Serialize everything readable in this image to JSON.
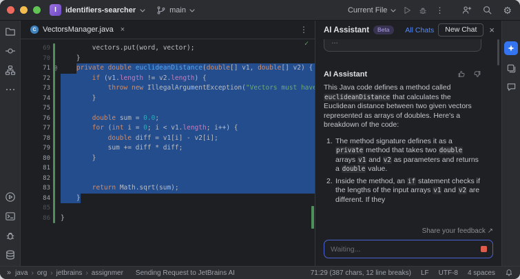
{
  "colors": {
    "accent": "#3574f0",
    "selection": "#234d8d",
    "editor_bg": "#1e1f22",
    "panel_bg": "#2b2d30",
    "keyword": "#cf8e6d",
    "method": "#56a8f5",
    "string": "#6aab73",
    "number": "#2aacb8",
    "field": "#c77dbb",
    "code_text": "#bcbec4",
    "link": "#548af7",
    "beta_text": "#b3a1ef",
    "stop_button": "#dd5c4c",
    "change_marker": "#4e8f5c",
    "success": "#5fad65"
  },
  "titlebar": {
    "project_name": "identifiers-searcher",
    "project_initial": "I",
    "branch_name": "main",
    "run_config": "Current File"
  },
  "tabbar": {
    "tab_title": "VectorsManager.java",
    "close_glyph": "×",
    "kebab_glyph": "⋮",
    "inspection_glyph": "✓"
  },
  "editor": {
    "lines": [
      {
        "n": 69,
        "sel": "none",
        "t": [
          [
            "pln",
            "        vectors.put(word, vector);"
          ]
        ]
      },
      {
        "n": 70,
        "sel": "none",
        "t": [
          [
            "pln",
            "    }"
          ]
        ]
      },
      {
        "n": 71,
        "sel": "tail",
        "mark": "@",
        "pre": [
          [
            "pln",
            "    "
          ]
        ],
        "t": [
          [
            "kw",
            "private"
          ],
          [
            "pln",
            " "
          ],
          [
            "kw",
            "double"
          ],
          [
            "pln",
            " "
          ],
          [
            "fn",
            "euclideanDistance"
          ],
          [
            "pln",
            "("
          ],
          [
            "kw",
            "double"
          ],
          [
            "pln",
            "[] v1, "
          ],
          [
            "kw",
            "double"
          ],
          [
            "pln",
            "[] v2) {"
          ]
        ]
      },
      {
        "n": 72,
        "sel": "full",
        "t": [
          [
            "pln",
            "        "
          ],
          [
            "kw",
            "if"
          ],
          [
            "pln",
            " (v1."
          ],
          [
            "fld",
            "length"
          ],
          [
            "pln",
            " != v2."
          ],
          [
            "fld",
            "length"
          ],
          [
            "pln",
            ") {"
          ]
        ]
      },
      {
        "n": 73,
        "sel": "full",
        "t": [
          [
            "pln",
            "            "
          ],
          [
            "kw",
            "throw"
          ],
          [
            "pln",
            " "
          ],
          [
            "kw",
            "new"
          ],
          [
            "pln",
            " IllegalArgumentException("
          ],
          [
            "str",
            "\"Vectors must have th"
          ]
        ]
      },
      {
        "n": 74,
        "sel": "full",
        "t": [
          [
            "pln",
            "        }"
          ]
        ]
      },
      {
        "n": 75,
        "sel": "full",
        "t": []
      },
      {
        "n": 76,
        "sel": "full",
        "t": [
          [
            "pln",
            "        "
          ],
          [
            "kw",
            "double"
          ],
          [
            "pln",
            " sum = "
          ],
          [
            "num",
            "0.0"
          ],
          [
            "pln",
            ";"
          ]
        ]
      },
      {
        "n": 77,
        "sel": "full",
        "t": [
          [
            "pln",
            "        "
          ],
          [
            "kw",
            "for"
          ],
          [
            "pln",
            " ("
          ],
          [
            "kw",
            "int"
          ],
          [
            "pln",
            " i = "
          ],
          [
            "num",
            "0"
          ],
          [
            "pln",
            "; i < v1."
          ],
          [
            "fld",
            "length"
          ],
          [
            "pln",
            "; i++) {"
          ]
        ]
      },
      {
        "n": 78,
        "sel": "full",
        "t": [
          [
            "pln",
            "            "
          ],
          [
            "kw",
            "double"
          ],
          [
            "pln",
            " diff = v1[i] - v2[i];"
          ]
        ]
      },
      {
        "n": 79,
        "sel": "full",
        "t": [
          [
            "pln",
            "            sum += diff * diff;"
          ]
        ]
      },
      {
        "n": 80,
        "sel": "full",
        "t": [
          [
            "pln",
            "        }"
          ]
        ]
      },
      {
        "n": 81,
        "sel": "full",
        "t": []
      },
      {
        "n": 82,
        "sel": "full",
        "t": []
      },
      {
        "n": 83,
        "sel": "full",
        "t": [
          [
            "pln",
            "        "
          ],
          [
            "kw",
            "return"
          ],
          [
            "pln",
            " Math.sqrt(sum);"
          ]
        ]
      },
      {
        "n": 84,
        "sel": "text",
        "t": [
          [
            "pln",
            "    }"
          ]
        ]
      },
      {
        "n": 85,
        "sel": "none",
        "t": []
      },
      {
        "n": 86,
        "sel": "none",
        "t": [
          [
            "pln",
            "}"
          ]
        ]
      }
    ]
  },
  "chat": {
    "title": "AI Assistant",
    "beta_badge": "Beta",
    "all_chats": "All Chats",
    "new_chat": "New Chat",
    "close_glyph": "×",
    "clipped_text": "…",
    "author": "AI Assistant",
    "intro": "This Java code defines a method called `euclideanDistance` that calculates the Euclidean distance between two given vectors represented as arrays of doubles. Here's a breakdown of the code:",
    "list_items": [
      "The method signature defines it as a `private` method that takes two `double` arrays `v1` and `v2` as parameters and returns a `double` value.",
      "Inside the method, an `if` statement checks if the lengths of the input arrays `v1` and `v2` are different. If they"
    ],
    "feedback_link": "Share your feedback ↗",
    "input_placeholder": "Waiting..."
  },
  "statusbar": {
    "chevrons_glyph": "»",
    "breadcrumbs": [
      "java",
      "org",
      "jetbrains",
      "assignmer"
    ],
    "status_message": "Sending Request to JetBrains AI",
    "caret_info": "71:29 (387 chars, 12 line breaks)",
    "line_ending": "LF",
    "encoding": "UTF-8",
    "indent_style": "4 spaces"
  }
}
